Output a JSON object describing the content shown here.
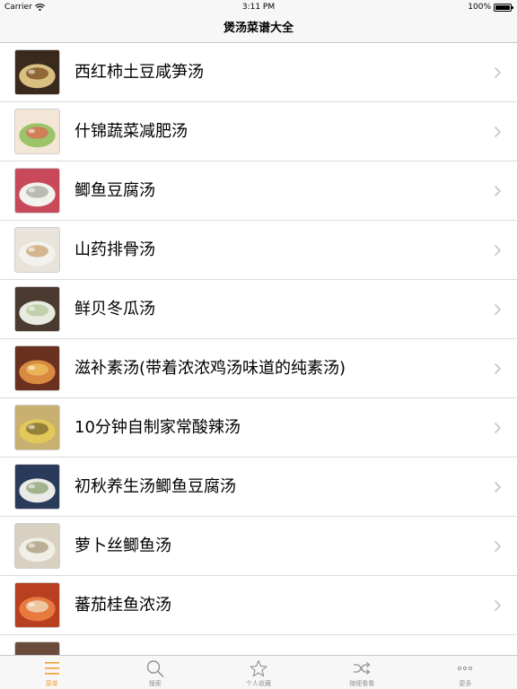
{
  "status_bar": {
    "carrier": "Carrier",
    "time": "3:11 PM",
    "battery": "100%"
  },
  "nav": {
    "title": "煲汤菜谱大全"
  },
  "recipes": [
    {
      "title": "西红柿土豆咸笋汤",
      "thumb_colors": [
        "#3a2a1e",
        "#d8c080",
        "#7a4a20"
      ]
    },
    {
      "title": "什锦蔬菜减肥汤",
      "thumb_colors": [
        "#f4e6d6",
        "#9bc46a",
        "#e06a50"
      ]
    },
    {
      "title": "鲫鱼豆腐汤",
      "thumb_colors": [
        "#c84a5a",
        "#f2f2ee",
        "#a8a8a0"
      ]
    },
    {
      "title": "山药排骨汤",
      "thumb_colors": [
        "#e8e4dc",
        "#f4f2ee",
        "#c9a070"
      ]
    },
    {
      "title": "鲜贝冬瓜汤",
      "thumb_colors": [
        "#4a3a30",
        "#e8ece0",
        "#b6c89a"
      ]
    },
    {
      "title": "滋补素汤(带着浓浓鸡汤味道的纯素汤)",
      "thumb_colors": [
        "#6a3020",
        "#d88a40",
        "#f0c060"
      ]
    },
    {
      "title": "10分钟自制家常酸辣汤",
      "thumb_colors": [
        "#c8b070",
        "#e2c858",
        "#7a6a30"
      ]
    },
    {
      "title": "初秋养生汤鲫鱼豆腐汤",
      "thumb_colors": [
        "#2a3a5a",
        "#eaeae6",
        "#8aa070"
      ]
    },
    {
      "title": "萝卜丝鲫鱼汤",
      "thumb_colors": [
        "#d8d0c0",
        "#f0eee6",
        "#a89878"
      ]
    },
    {
      "title": "蕃茄桂鱼浓汤",
      "thumb_colors": [
        "#b84020",
        "#e87a40",
        "#f0e0c0"
      ]
    },
    {
      "title": "",
      "thumb_colors": [
        "#6a4a3a",
        "#c8b090",
        "#e8d8c0"
      ]
    }
  ],
  "tabs": [
    {
      "label": "菜单",
      "icon": "menu-icon",
      "active": true
    },
    {
      "label": "搜索",
      "icon": "search-icon",
      "active": false
    },
    {
      "label": "个人收藏",
      "icon": "star-icon",
      "active": false
    },
    {
      "label": "随便看看",
      "icon": "shuffle-icon",
      "active": false
    },
    {
      "label": "更多",
      "icon": "more-icon",
      "active": false
    }
  ],
  "colors": {
    "accent": "#f0a030",
    "tab_inactive": "#929292",
    "chevron": "#c7c7cc",
    "separator": "#dcdcdf"
  }
}
